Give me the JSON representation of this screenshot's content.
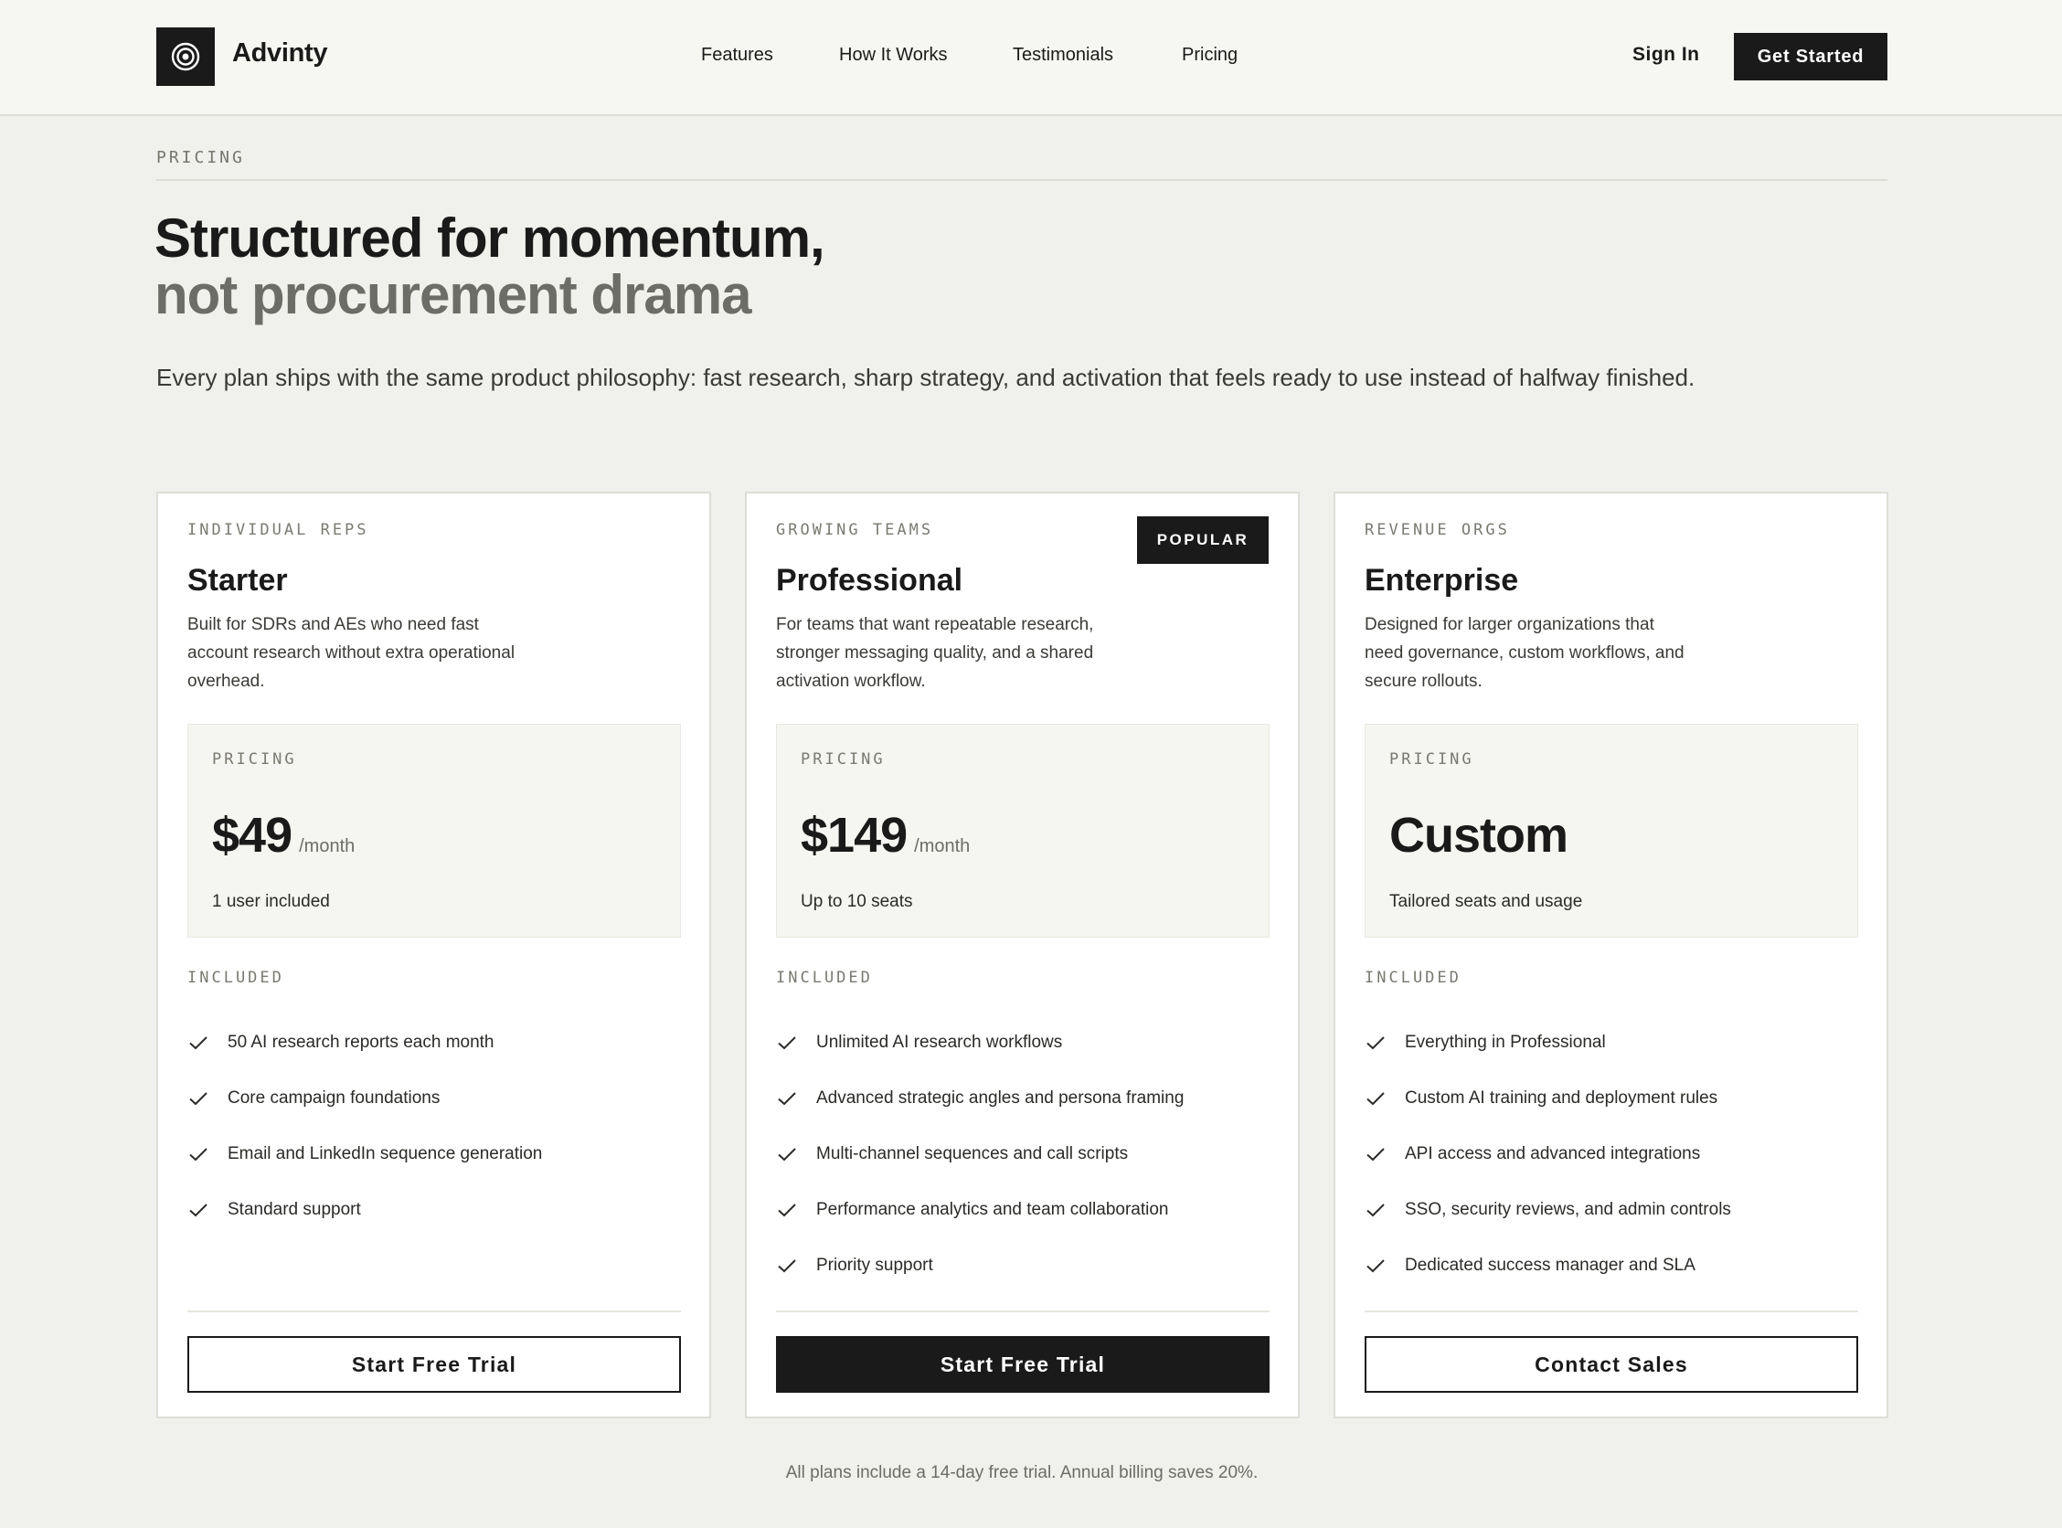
{
  "nav": {
    "brand": "Advinty",
    "links": [
      "Features",
      "How It Works",
      "Testimonials",
      "Pricing"
    ],
    "sign_in": "Sign In",
    "get_started": "Get Started"
  },
  "hero": {
    "eyebrow": "PRICING",
    "title_line1": "Structured for momentum,",
    "title_line2": "not procurement drama",
    "lede": "Every plan ships with the same product philosophy: fast research, sharp strategy, and activation that feels ready to use instead of halfway finished."
  },
  "plans": [
    {
      "tier": "INDIVIDUAL REPS",
      "name": "Starter",
      "description": "Built for SDRs and AEs who need fast account research without extra operational overhead.",
      "pricing_label": "PRICING",
      "price": "$49",
      "period": "/month",
      "price_note": "1 user included",
      "included_label": "INCLUDED",
      "features": [
        "50 AI research reports each month",
        "Core campaign foundations",
        "Email and LinkedIn sequence generation",
        "Standard support"
      ],
      "cta": "Start Free Trial"
    },
    {
      "tier": "GROWING TEAMS",
      "badge": "POPULAR",
      "name": "Professional",
      "description": "For teams that want repeatable research, stronger messaging quality, and a shared activation workflow.",
      "pricing_label": "PRICING",
      "price": "$149",
      "period": "/month",
      "price_note": "Up to 10 seats",
      "included_label": "INCLUDED",
      "features": [
        "Unlimited AI research workflows",
        "Advanced strategic angles and persona framing",
        "Multi-channel sequences and call scripts",
        "Performance analytics and team collaboration",
        "Priority support"
      ],
      "cta": "Start Free Trial"
    },
    {
      "tier": "REVENUE ORGS",
      "name": "Enterprise",
      "description": "Designed for larger organizations that need governance, custom workflows, and secure rollouts.",
      "pricing_label": "PRICING",
      "price": "Custom",
      "price_note": "Tailored seats and usage",
      "included_label": "INCLUDED",
      "features": [
        "Everything in Professional",
        "Custom AI training and deployment rules",
        "API access and advanced integrations",
        "SSO, security reviews, and admin controls",
        "Dedicated success manager and SLA"
      ],
      "cta": "Contact Sales"
    }
  ],
  "footnote": "All plans include a 14-day free trial. Annual billing saves 20%.",
  "colors": {
    "background": "#f0f0ec",
    "nav_background": "#f6f6f2",
    "ink": "#1a1a1a",
    "muted_title": "#6d6d67",
    "card": "#ffffff",
    "price_box": "#f5f5f1"
  },
  "icons": {
    "logo": "concentric-target-icon",
    "feature_bullet": "check-icon"
  }
}
